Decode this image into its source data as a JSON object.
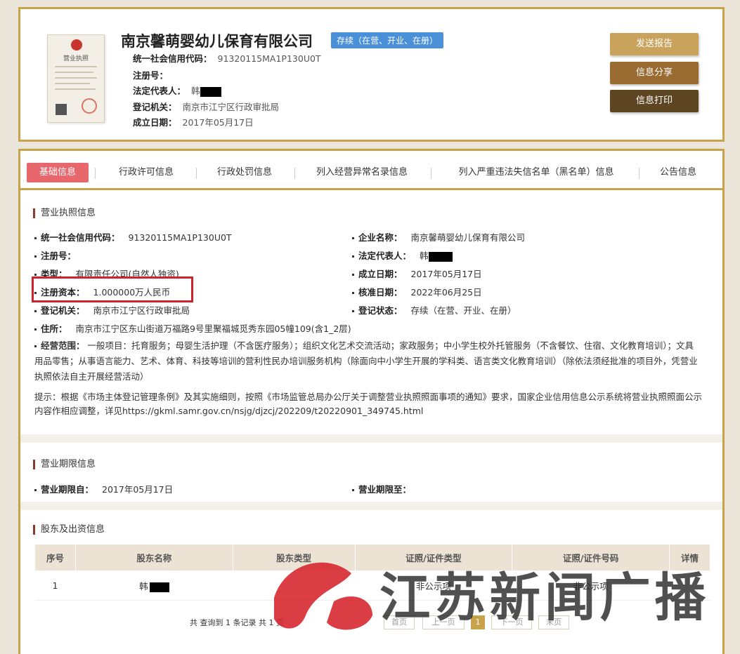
{
  "header": {
    "company_name": "南京馨萌婴幼儿保育有限公司",
    "status_badge": "存续（在营、开业、在册）",
    "credit_code_label": "统一社会信用代码：",
    "credit_code": "91320115MA1P130U0T",
    "reg_no_label": "注册号：",
    "legal_rep_label": "法定代表人：",
    "legal_rep": "韩",
    "authority_label": "登记机关：",
    "authority": "南京市江宁区行政审批局",
    "founded_label": "成立日期：",
    "founded": "2017年05月17日",
    "license_img_title": "营业执照"
  },
  "actions": {
    "send_report": "发送报告",
    "share": "信息分享",
    "print": "信息打印"
  },
  "tabs": [
    {
      "label": "基础信息"
    },
    {
      "label": "行政许可信息"
    },
    {
      "label": "行政处罚信息"
    },
    {
      "label": "列入经营异常名录信息"
    },
    {
      "label": "列入严重违法失信名单（黑名单）信息"
    },
    {
      "label": "公告信息"
    }
  ],
  "license": {
    "section_title": "营业执照信息",
    "credit_code_label": "统一社会信用代码：",
    "credit_code": "91320115MA1P130U0T",
    "name_label": "企业名称：",
    "name": "南京馨萌婴幼儿保育有限公司",
    "reg_no_label": "注册号：",
    "legal_rep_label": "法定代表人：",
    "legal_rep": "韩",
    "type_label": "类型：",
    "type": "有限责任公司(自然人独资)",
    "founded_label": "成立日期：",
    "founded": "2017年05月17日",
    "capital_label": "注册资本：",
    "capital": "1.000000万人民币",
    "approval_label": "核准日期：",
    "approval": "2022年06月25日",
    "authority_label": "登记机关：",
    "authority": "南京市江宁区行政审批局",
    "reg_status_label": "登记状态：",
    "reg_status": "存续（在营、开业、在册）",
    "address_label": "住所：",
    "address": "南京市江宁区东山街道万福路9号里聚福城觅秀东园05幢109(含1_2层)",
    "scope_label": "经营范围：",
    "scope": "一般项目：托育服务；母婴生活护理（不含医疗服务）；组织文化艺术交流活动；家政服务；中小学生校外托管服务（不含餐饮、住宿、文化教育培训）；文具用品零售；从事语言能力、艺术、体育、科技等培训的营利性民办培训服务机构（除面向中小学生开展的学科类、语言类文化教育培训）（除依法须经批准的项目外，凭营业执照依法自主开展经营活动）",
    "tip": "提示：根据《市场主体登记管理条例》及其实施细则，按照《市场监管总局办公厅关于调整营业执照照面事项的通知》要求，国家企业信用信息公示系统将营业执照照面公示内容作相应调整，详见https://gkml.samr.gov.cn/nsjg/djzcj/202209/t20220901_349745.html"
  },
  "term": {
    "section_title": "营业期限信息",
    "from_label": "营业期限自：",
    "from": "2017年05月17日",
    "to_label": "营业期限至："
  },
  "shareholders": {
    "section_title": "股东及出资信息",
    "columns": [
      "序号",
      "股东名称",
      "股东类型",
      "证照/证件类型",
      "证照/证件号码",
      "详情"
    ],
    "rows": [
      {
        "no": "1",
        "name": "韩",
        "type": "",
        "id_type": "非公示项",
        "id_no": "非公示项",
        "detail": ""
      }
    ],
    "summary": "共 查询到 1 条记录 共 1 页",
    "pager": {
      "first": "首页",
      "prev": "上一页",
      "current": "1",
      "next": "下一页",
      "last": "末页"
    }
  },
  "watermark": {
    "text": "江苏新闻广播"
  },
  "colors": {
    "gold_border": "#c9a24c",
    "active_tab": "#e8676d",
    "badge": "#4a90d9",
    "highlight": "#d0222a"
  }
}
